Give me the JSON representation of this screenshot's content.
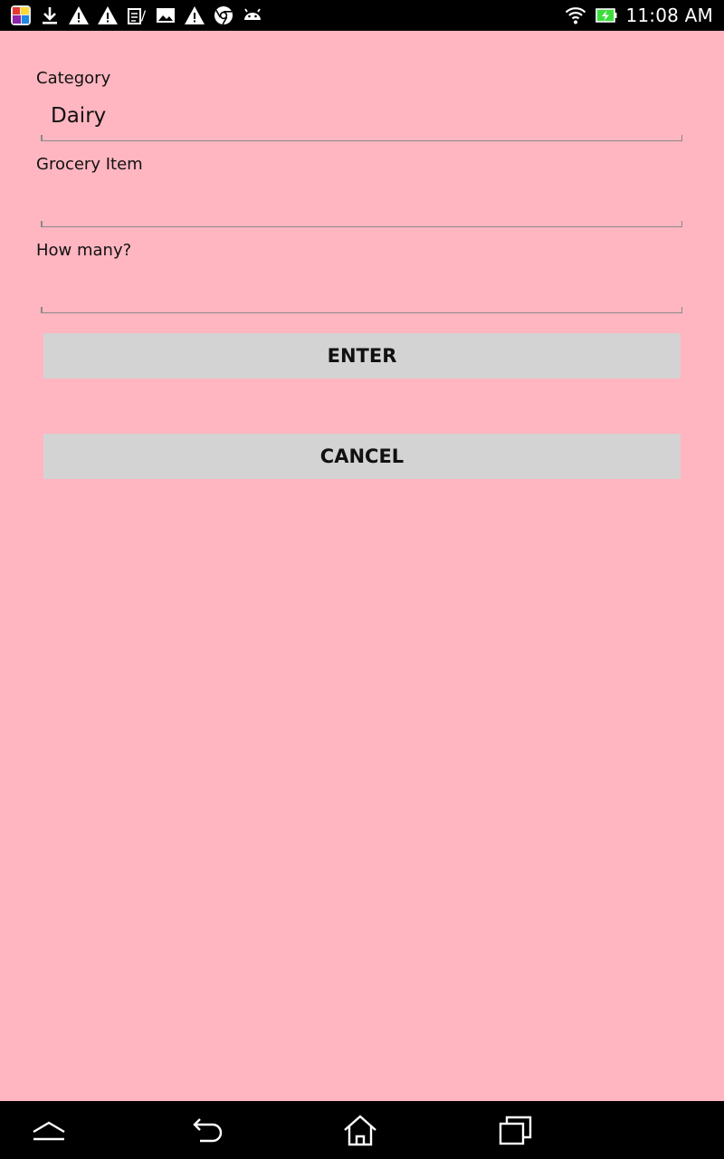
{
  "status_bar": {
    "time": "11:08 AM",
    "left_icons": [
      "app-icon",
      "download-icon",
      "warning-icon",
      "warning-icon",
      "document-icon",
      "image-icon",
      "warning-icon",
      "chrome-icon",
      "android-icon"
    ],
    "right_icons": [
      "wifi-icon",
      "battery-charging-icon"
    ]
  },
  "form": {
    "category_label": "Category",
    "category_value": "Dairy",
    "item_label": "Grocery Item",
    "item_value": "",
    "quantity_label": "How many?",
    "quantity_value": ""
  },
  "buttons": {
    "enter": "ENTER",
    "cancel": "CANCEL"
  },
  "nav_bar": {
    "icons": [
      "collapse-icon",
      "back-icon",
      "home-icon",
      "recents-icon"
    ]
  },
  "colors": {
    "background": "#FFB6C1",
    "button": "#D3D3D3",
    "bars": "#000000",
    "battery_accent": "#3ddc3d"
  }
}
